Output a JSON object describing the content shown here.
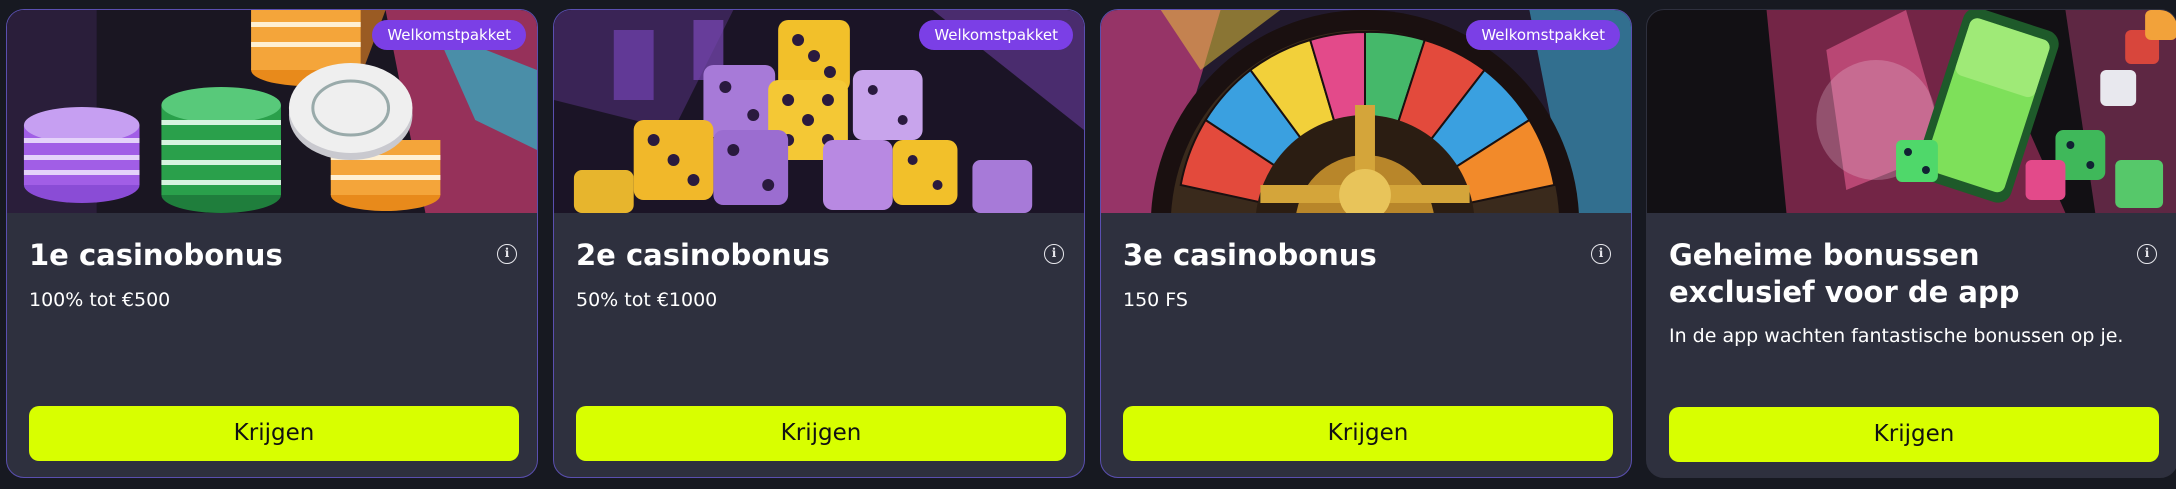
{
  "cards": [
    {
      "badge": "Welkomstpakket",
      "title": "1e casinobonus",
      "subtitle": "100% tot €500",
      "button": "Krijgen",
      "info": "i"
    },
    {
      "badge": "Welkomstpakket",
      "title": "2e casinobonus",
      "subtitle": "50% tot €1000",
      "button": "Krijgen",
      "info": "i"
    },
    {
      "badge": "Welkomstpakket",
      "title": "3e casinobonus",
      "subtitle": "150 FS",
      "button": "Krijgen",
      "info": "i"
    },
    {
      "badge": "",
      "title": "Geheime bonussen exclusief voor de app",
      "subtitle": "In de app wachten fantastische bonussen op je.",
      "button": "Krijgen",
      "info": "i"
    }
  ],
  "colors": {
    "background": "#171921",
    "card": "#2e303e",
    "badge": "#7b3fe6",
    "button": "#d8ff00",
    "border": "#5a4fb0"
  },
  "icons": {
    "info": "info-icon",
    "card_art": [
      "casino-chips-illustration",
      "dice-illustration",
      "roulette-wheel-illustration",
      "phone-app-illustration"
    ]
  }
}
